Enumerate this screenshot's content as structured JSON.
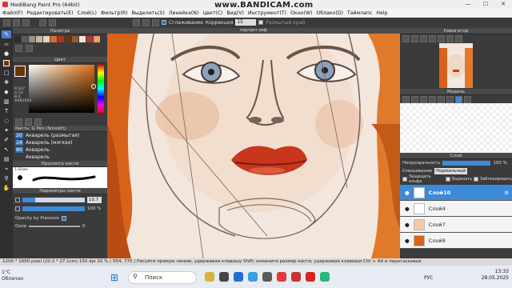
{
  "window": {
    "title": "MediBang Paint Pro (64bit)",
    "watermark": "www.BANDICAM.com",
    "minimize": "—",
    "maximize": "☐",
    "close": "✕"
  },
  "menu": [
    "Файл(F)",
    "Редактировать(E)",
    "Слой(L)",
    "Фильтр(R)",
    "Выделить(S)",
    "Линейка(N)",
    "Цвет(C)",
    "Вид(V)",
    "Инструмент(T)",
    "Окно(W)",
    "Облако(D)",
    "Таймлапс",
    "Help"
  ],
  "toolbar": {
    "antialias_label": "Сглаживание",
    "correction_label": "Коррекция",
    "correction_value": "15",
    "soft_edge_label": "Размытый край"
  },
  "panels": {
    "palette": "Палитра",
    "color": "Цвет",
    "color_readout": [
      "R:107",
      "G:53",
      "B:3",
      "#6B3503"
    ],
    "brush": "Кисть: G Pen (Smooth)",
    "brush_preview": "Просмотр кисти",
    "brush_params": "Параметры кисти",
    "brush_size_value": "10.7",
    "brush_opacity_value": "100 %",
    "opacity_by_pressure": "Opacity by Pressure",
    "ooze_label": "Ooze",
    "ooze_value": "0",
    "preview_size": "1.42мм",
    "navigator": "Навигатор",
    "model": "Модель",
    "layer": "Слой",
    "opacity_label": "Непрозрачность",
    "opacity_value": "100 %",
    "blend_label": "Смешивание",
    "blend_value": "Нормальный",
    "protect_alpha": "Защищать альфа",
    "clip_label": "Вырезать",
    "lock_label": "Заблокировать",
    "canvas_title": "портрет лиф"
  },
  "brushes": [
    {
      "size": "20",
      "name": "Акварель (размытая)"
    },
    {
      "size": "24",
      "name": "Акварель (мягкая)"
    },
    {
      "size": "80",
      "name": "Акварель"
    },
    {
      "size": "",
      "name": "Акварель"
    }
  ],
  "layers": [
    {
      "name": "Слой10",
      "selected": true
    },
    {
      "name": "Слой4",
      "selected": false
    },
    {
      "name": "Слой7",
      "selected": false
    },
    {
      "name": "Слой9",
      "selected": false
    }
  ],
  "status": "1200 * 1600 pixel   (20.3 * 27.1cm)   150 dpi   20 %   ( 554, 770 )   Рисуйте прямую линию, удерживая клавишу Shift; измените размер кисти, удерживая клавиши Ctrl + Alt и перетаскивая",
  "taskbar": {
    "weather_temp": "1°C",
    "weather_desc": "Облачно",
    "search_placeholder": "Поиск",
    "time": "13:33",
    "date": "28.05.2025",
    "lang": "РУС"
  },
  "colors": {
    "accent": "#3d8ad9",
    "current_color": "#6B3503",
    "lips": "#c8361e"
  }
}
